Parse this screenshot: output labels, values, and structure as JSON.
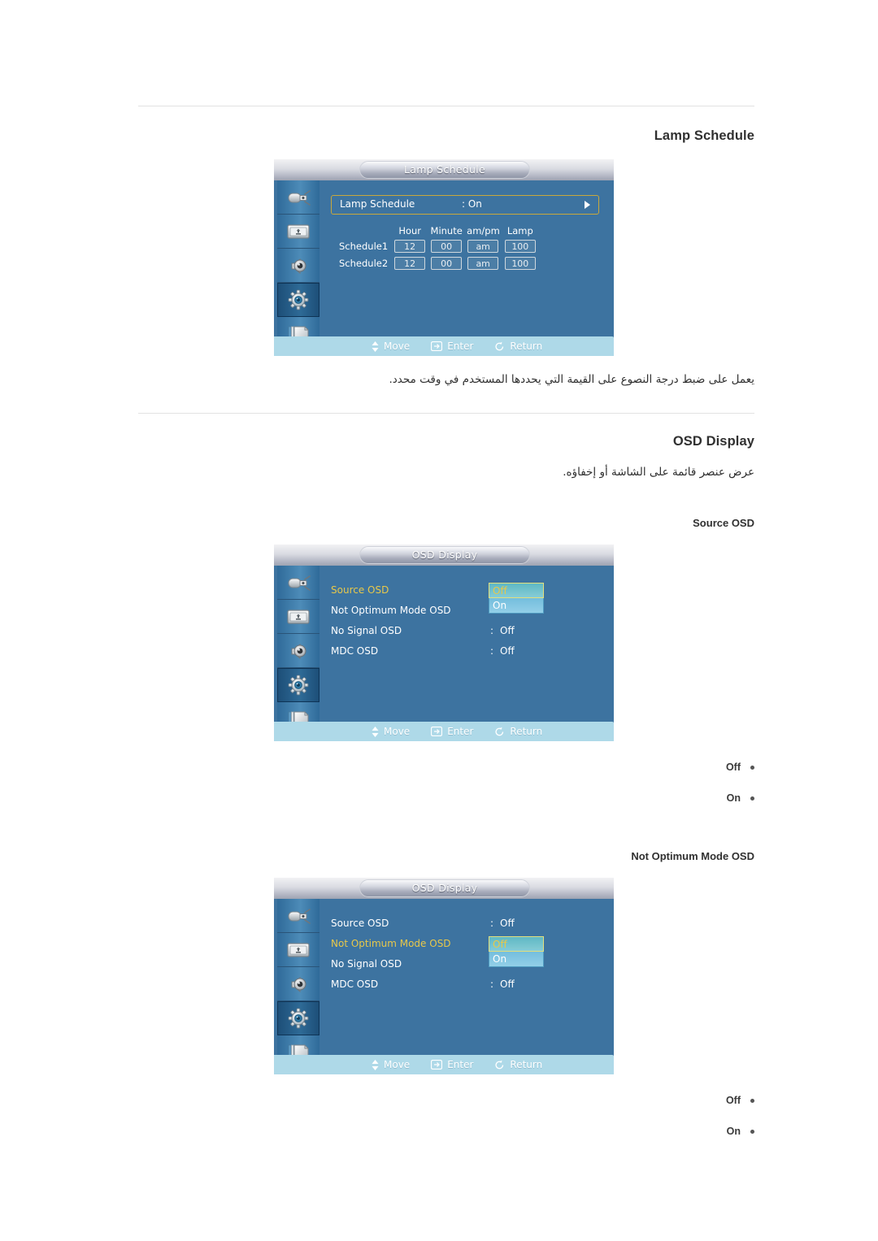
{
  "page": {
    "sections": [
      {
        "heading": "Lamp Schedule",
        "description_ar": "يعمل على ضبط درجة النصوع على القيمة التي يحددها المستخدم في وقت محدد."
      },
      {
        "heading": "OSD Display",
        "description_ar": "عرض عنصر قائمة على الشاشة أو إخفاؤه."
      }
    ],
    "subheadings": {
      "source_osd": "Source OSD",
      "not_optimum_mode_osd": "Not Optimum Mode OSD"
    }
  },
  "osd_nav": {
    "move": "Move",
    "enter": "Enter",
    "return": "Return",
    "move_icon": "up-down-arrow-icon",
    "enter_icon": "enter-key-icon",
    "return_icon": "return-arrow-icon"
  },
  "sidebar_icons": [
    "input-source-icon",
    "picture-icon",
    "sound-speaker-icon",
    "setup-gear-icon",
    "multi-control-icon"
  ],
  "lamp_schedule_screen": {
    "title": "Lamp Schedule",
    "row": {
      "label": "Lamp Schedule",
      "colon_value": ": On",
      "arrow_icon": "right-arrow-icon"
    },
    "table": {
      "columns": [
        "Hour",
        "Minute",
        "am/pm",
        "Lamp"
      ],
      "rows": [
        {
          "name": "Schedule1",
          "values": [
            "12",
            "00",
            "am",
            "100"
          ]
        },
        {
          "name": "Schedule2",
          "values": [
            "12",
            "00",
            "am",
            "100"
          ]
        }
      ]
    }
  },
  "osd_display_screen_1": {
    "title": "OSD Display",
    "items": [
      {
        "label": "Source OSD",
        "colon": ":",
        "value": "",
        "selected": true,
        "has_dropdown": true
      },
      {
        "label": "Not Optimum Mode OSD",
        "colon": ":",
        "value": "",
        "selected": false,
        "has_dropdown": false
      },
      {
        "label": "No Signal OSD",
        "colon": ":",
        "value": "Off",
        "selected": false,
        "has_dropdown": false
      },
      {
        "label": "MDC OSD",
        "colon": ":",
        "value": "Off",
        "selected": false,
        "has_dropdown": false
      }
    ],
    "dropdown": {
      "highlighted": "Off",
      "other": "On"
    }
  },
  "osd_display_screen_2": {
    "title": "OSD Display",
    "items": [
      {
        "label": "Source OSD",
        "colon": ":",
        "value": "Off",
        "selected": false,
        "has_dropdown": false
      },
      {
        "label": "Not Optimum Mode OSD",
        "colon": ":",
        "value": "",
        "selected": true,
        "has_dropdown": true
      },
      {
        "label": "No Signal OSD",
        "colon": ":",
        "value": "",
        "selected": false,
        "has_dropdown": false
      },
      {
        "label": "MDC OSD",
        "colon": ":",
        "value": "Off",
        "selected": false,
        "has_dropdown": false
      }
    ],
    "dropdown": {
      "highlighted": "Off",
      "other": "On"
    }
  },
  "option_lists": {
    "source_osd": [
      "Off",
      "On"
    ],
    "not_optimum_mode_osd": [
      "Off",
      "On"
    ]
  },
  "colors": {
    "panel_blue": "#3d73a0",
    "sidebar_blue": "#4d8cb8",
    "sidebar_active": "#1d4f78",
    "bottom_bar": "#aed9e8",
    "highlight_yellow": "#e8c84a",
    "dropdown_teal": "#5fb8c4",
    "dropdown_blue": "#74bedd",
    "divider_gray": "#e2e2e2"
  }
}
